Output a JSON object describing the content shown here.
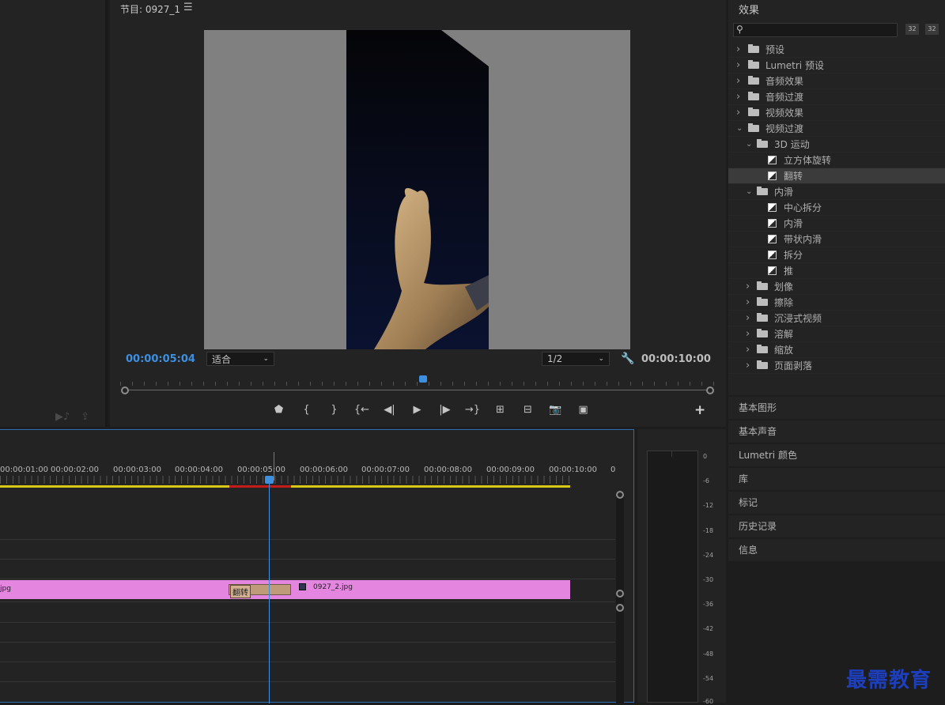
{
  "program": {
    "title": "节目: 0927_1",
    "menu_icon": "☰",
    "timecode_current": "00:00:05:04",
    "timecode_total": "00:00:10:00",
    "zoom_value": "适合",
    "resolution_value": "1/2"
  },
  "transport": {
    "buttons": [
      "marker-icon",
      "mark-in-icon",
      "mark-out-icon",
      "go-to-in-icon",
      "step-back-icon",
      "play-icon",
      "step-forward-icon",
      "go-to-out-icon",
      "lift-icon",
      "extract-icon",
      "export-frame-icon",
      "compare-icon"
    ],
    "glyphs": [
      "⬟",
      "{",
      "}",
      "{←",
      "◀|",
      "▶",
      "|▶",
      "→}",
      "⊞",
      "⊟",
      "📷",
      "▣"
    ],
    "add_label": "+"
  },
  "timeline": {
    "ruler": [
      "00:00:01:00",
      "00:00:02:00",
      "00:00:03:00",
      "00:00:04:00",
      "00:00:05:00",
      "00:00:06:00",
      "00:00:07:00",
      "00:00:08:00",
      "00:00:09:00",
      "00:00:10:00",
      "0"
    ],
    "clip1_name": "jpg",
    "transition_name": "翻转",
    "clip2_name": "0927_2.jpg",
    "playhead_time": "00:00:05:04"
  },
  "meter": {
    "scale": [
      "0",
      "-6",
      "-12",
      "-18",
      "-24",
      "-30",
      "-36",
      "-42",
      "-48",
      "-54",
      "-60"
    ]
  },
  "effects": {
    "title": "效果",
    "search_placeholder": "",
    "icon_a": "32",
    "icon_b": "32",
    "tree": [
      {
        "label": "预设",
        "level": 0,
        "expanded": false,
        "type": "folder-star"
      },
      {
        "label": "Lumetri 预设",
        "level": 0,
        "expanded": false,
        "type": "folder-star"
      },
      {
        "label": "音频效果",
        "level": 0,
        "expanded": false,
        "type": "folder"
      },
      {
        "label": "音频过渡",
        "level": 0,
        "expanded": false,
        "type": "folder"
      },
      {
        "label": "视频效果",
        "level": 0,
        "expanded": false,
        "type": "folder"
      },
      {
        "label": "视频过渡",
        "level": 0,
        "expanded": true,
        "type": "folder"
      },
      {
        "label": "3D 运动",
        "level": 1,
        "expanded": true,
        "type": "folder"
      },
      {
        "label": "立方体旋转",
        "level": 2,
        "type": "effect"
      },
      {
        "label": "翻转",
        "level": 2,
        "type": "effect",
        "selected": true
      },
      {
        "label": "内滑",
        "level": 1,
        "expanded": true,
        "type": "folder"
      },
      {
        "label": "中心拆分",
        "level": 2,
        "type": "effect"
      },
      {
        "label": "内滑",
        "level": 2,
        "type": "effect"
      },
      {
        "label": "带状内滑",
        "level": 2,
        "type": "effect"
      },
      {
        "label": "拆分",
        "level": 2,
        "type": "effect"
      },
      {
        "label": "推",
        "level": 2,
        "type": "effect"
      },
      {
        "label": "划像",
        "level": 1,
        "expanded": false,
        "type": "folder"
      },
      {
        "label": "擦除",
        "level": 1,
        "expanded": false,
        "type": "folder"
      },
      {
        "label": "沉浸式视频",
        "level": 1,
        "expanded": false,
        "type": "folder"
      },
      {
        "label": "溶解",
        "level": 1,
        "expanded": false,
        "type": "folder"
      },
      {
        "label": "缩放",
        "level": 1,
        "expanded": false,
        "type": "folder"
      },
      {
        "label": "页面剥落",
        "level": 1,
        "expanded": false,
        "type": "folder"
      }
    ]
  },
  "panels": [
    "基本图形",
    "基本声音",
    "Lumetri 颜色",
    "库",
    "标记",
    "历史记录",
    "信息"
  ],
  "watermark": "最需教育",
  "colors": {
    "accent": "#3d8fe0",
    "clip": "#e486e0",
    "transition": "#c09b7a",
    "workarea": "#d7c818",
    "watermark": "#1d3fbd"
  }
}
